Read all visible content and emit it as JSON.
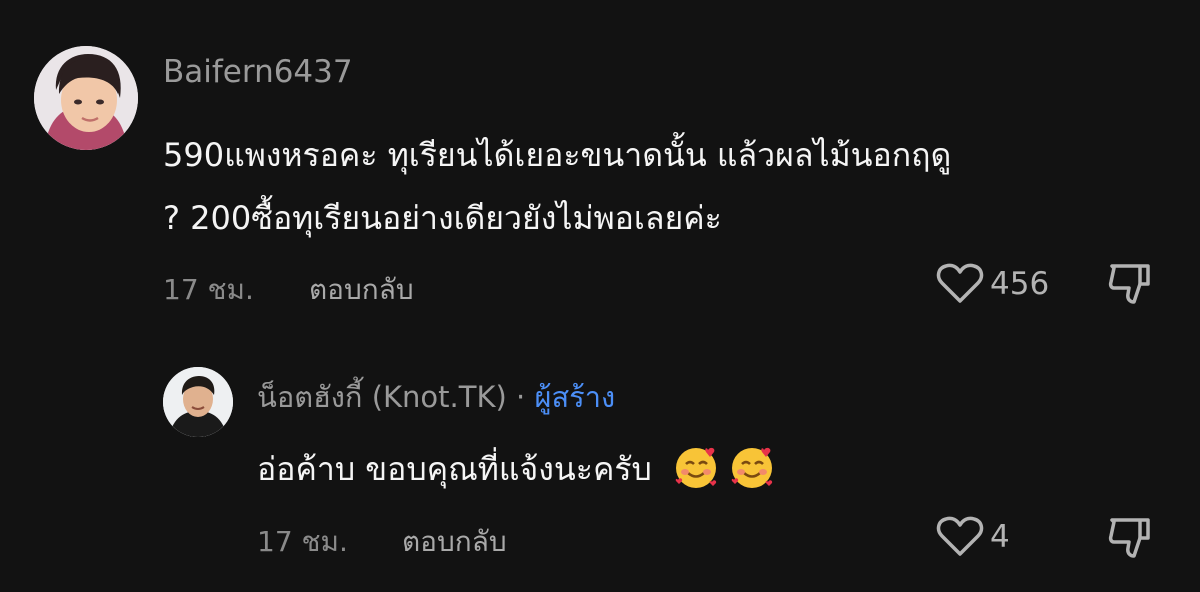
{
  "comments": [
    {
      "username": "Baifern6437",
      "text_line1": "590แพงหรอคะ ทุเรียนได้เยอะขนาดนั้น แล้วผลไม้นอกฤดู",
      "text_line2": "? 200ซื้อทุเรียนอย่างเดียวยังไม่พอเลยค่ะ",
      "time": "17 ชม.",
      "reply_label": "ตอบกลับ",
      "likes": "456",
      "icons": {
        "like": "heart-outline-icon",
        "dislike": "thumbs-down-icon"
      }
    }
  ],
  "reply": {
    "username": "น็อตฮังกี้ (Knot.TK)",
    "separator": "·",
    "creator_badge": "ผู้สร้าง",
    "text": "อ่อค้าบ ขอบคุณที่แจ้งนะครับ",
    "emojis": "🥰🥰",
    "time": "17 ชม.",
    "reply_label": "ตอบกลับ",
    "likes": "4",
    "icons": {
      "like": "heart-outline-icon",
      "dislike": "thumbs-down-icon",
      "emoji": "smiling-face-with-hearts-emoji"
    }
  },
  "colors": {
    "background": "#121212",
    "text": "#f5f5f5",
    "muted": "#8a8a8a",
    "creator": "#4c8ff7"
  }
}
